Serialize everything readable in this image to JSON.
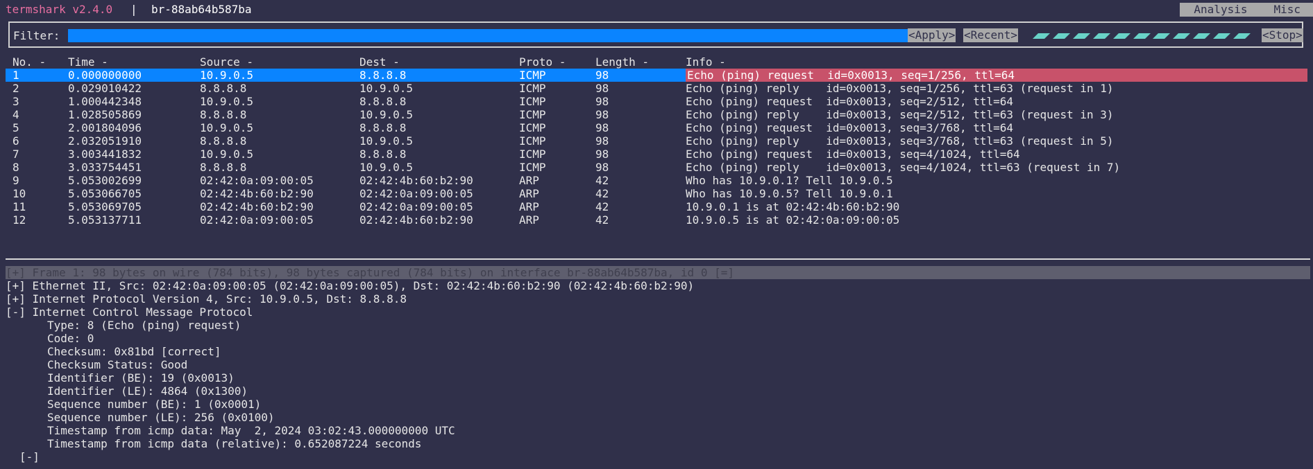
{
  "titlebar": {
    "app_title": "termshark v2.4.0",
    "separator": "|",
    "interface": "br-88ab64b587ba",
    "menu": [
      "Analysis",
      "Misc"
    ]
  },
  "filter": {
    "label": "Filter:",
    "value": "",
    "apply": "<Apply>",
    "recent": "<Recent>",
    "stop": "<Stop>"
  },
  "packet_list": {
    "headers": [
      "No. -",
      "Time -",
      "Source -",
      "Dest -",
      "Proto -",
      "Length -",
      "Info -"
    ],
    "rows": [
      [
        "1",
        "0.000000000",
        "10.9.0.5",
        "8.8.8.8",
        "ICMP",
        "98",
        "Echo (ping) request  id=0x0013, seq=1/256, ttl=64"
      ],
      [
        "2",
        "0.029010422",
        "8.8.8.8",
        "10.9.0.5",
        "ICMP",
        "98",
        "Echo (ping) reply    id=0x0013, seq=1/256, ttl=63 (request in 1)"
      ],
      [
        "3",
        "1.000442348",
        "10.9.0.5",
        "8.8.8.8",
        "ICMP",
        "98",
        "Echo (ping) request  id=0x0013, seq=2/512, ttl=64"
      ],
      [
        "4",
        "1.028505869",
        "8.8.8.8",
        "10.9.0.5",
        "ICMP",
        "98",
        "Echo (ping) reply    id=0x0013, seq=2/512, ttl=63 (request in 3)"
      ],
      [
        "5",
        "2.001804096",
        "10.9.0.5",
        "8.8.8.8",
        "ICMP",
        "98",
        "Echo (ping) request  id=0x0013, seq=3/768, ttl=64"
      ],
      [
        "6",
        "2.032051910",
        "8.8.8.8",
        "10.9.0.5",
        "ICMP",
        "98",
        "Echo (ping) reply    id=0x0013, seq=3/768, ttl=63 (request in 5)"
      ],
      [
        "7",
        "3.003441832",
        "10.9.0.5",
        "8.8.8.8",
        "ICMP",
        "98",
        "Echo (ping) request  id=0x0013, seq=4/1024, ttl=64"
      ],
      [
        "8",
        "3.033754451",
        "8.8.8.8",
        "10.9.0.5",
        "ICMP",
        "98",
        "Echo (ping) reply    id=0x0013, seq=4/1024, ttl=63 (request in 7)"
      ],
      [
        "9",
        "5.053002699",
        "02:42:0a:09:00:05",
        "02:42:4b:60:b2:90",
        "ARP",
        "42",
        "Who has 10.9.0.1? Tell 10.9.0.5"
      ],
      [
        "10",
        "5.053066705",
        "02:42:4b:60:b2:90",
        "02:42:0a:09:00:05",
        "ARP",
        "42",
        "Who has 10.9.0.5? Tell 10.9.0.1"
      ],
      [
        "11",
        "5.053069705",
        "02:42:4b:60:b2:90",
        "02:42:0a:09:00:05",
        "ARP",
        "42",
        "10.9.0.1 is at 02:42:4b:60:b2:90"
      ],
      [
        "12",
        "5.053137711",
        "02:42:0a:09:00:05",
        "02:42:4b:60:b2:90",
        "ARP",
        "42",
        "10.9.0.5 is at 02:42:0a:09:00:05"
      ]
    ],
    "selected_row": 1
  },
  "details": {
    "frame": "[+] Frame 1: 98 bytes on wire (784 bits), 98 bytes captured (784 bits) on interface br-88ab64b587ba, id 0 [=]",
    "ethernet": "[+] Ethernet II, Src: 02:42:0a:09:00:05 (02:42:0a:09:00:05), Dst: 02:42:4b:60:b2:90 (02:42:4b:60:b2:90)",
    "ip": "[+] Internet Protocol Version 4, Src: 10.9.0.5, Dst: 8.8.8.8",
    "icmp": "[-] Internet Control Message Protocol",
    "icmp_fields": [
      "Type: 8 (Echo (ping) request)",
      "Code: 0",
      "Checksum: 0x81bd [correct]",
      "Checksum Status: Good",
      "Identifier (BE): 19 (0x0013)",
      "Identifier (LE): 4864 (0x1300)",
      "Sequence number (BE): 1 (0x0001)",
      "Sequence number (LE): 256 (0x0100)",
      "Timestamp from icmp data: May  2, 2024 03:02:43.000000000 UTC",
      "Timestamp from icmp data (relative): 0.652087224 seconds"
    ],
    "data_toggle": "[-]"
  },
  "colors": {
    "background": "#30304a",
    "selection": "#0a84ff",
    "info_highlight": "#c8526a",
    "spinner": "#69d2c7",
    "title": "#e86fa1"
  }
}
